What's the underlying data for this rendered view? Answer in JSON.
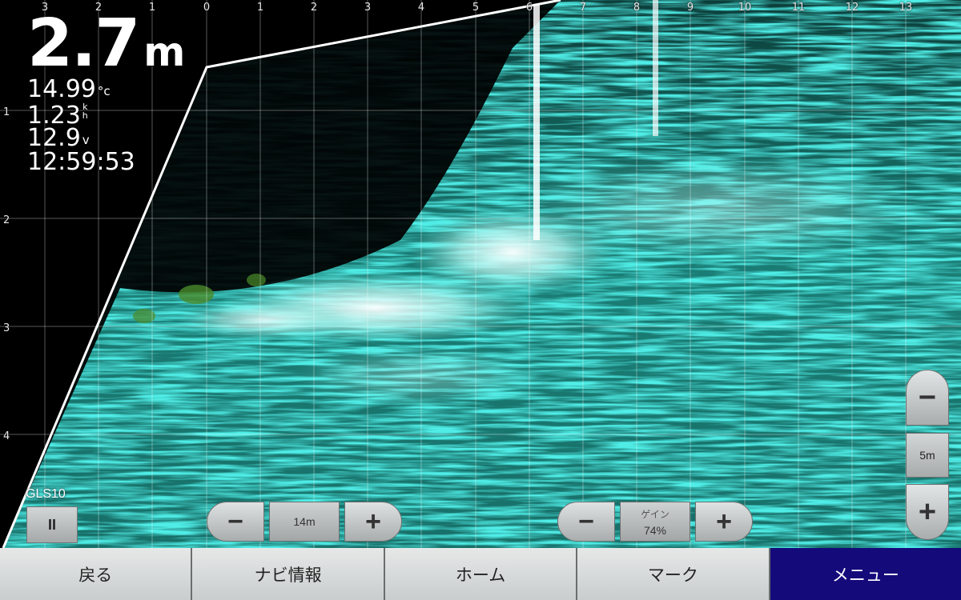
{
  "readout": {
    "depth_value": "2.7",
    "depth_unit": "m",
    "temperature_value": "14.99",
    "temperature_unit": "°c",
    "speed_value": "1.23",
    "speed_unit_top": "k",
    "speed_unit_bottom": "h",
    "voltage_value": "12.9",
    "voltage_unit": "v",
    "time": "12:59:53"
  },
  "range_scale": [
    "3",
    "2",
    "1",
    "0",
    "1",
    "2",
    "3",
    "4",
    "5",
    "6",
    "7",
    "8",
    "9",
    "10",
    "11",
    "12",
    "13"
  ],
  "depth_scale": [
    "1",
    "2",
    "3",
    "4"
  ],
  "source": {
    "label": "GLS10",
    "pause_label": "II"
  },
  "range_control": {
    "minus_label": "−",
    "value": "14m",
    "plus_label": "+"
  },
  "gain_control": {
    "minus_label": "−",
    "title": "ゲイン",
    "value": "74%",
    "plus_label": "+"
  },
  "zoom_control": {
    "minus_label": "−",
    "value": "5m",
    "plus_label": "+"
  },
  "nav": {
    "back": "戻る",
    "navi_info": "ナビ情報",
    "home": "ホーム",
    "mark": "マーク",
    "menu": "メニュー"
  },
  "colors": {
    "sonar_return": "#3fd9cc",
    "active_tab": "#150a7a"
  }
}
